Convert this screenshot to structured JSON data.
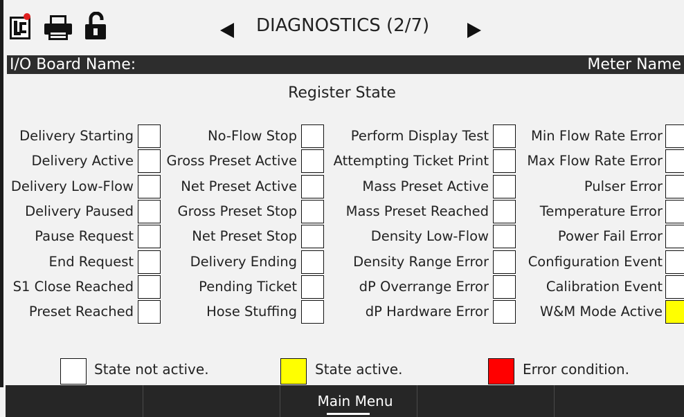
{
  "header": {
    "title": "DIAGNOSTICS (2/7)",
    "icons": [
      "app-logo-icon",
      "printer-icon",
      "unlock-icon",
      "prev-arrow-icon",
      "next-arrow-icon"
    ]
  },
  "board": {
    "label": "I/O Board Name:",
    "meter_name": "Meter Name"
  },
  "section_title": "Register State",
  "colors": {
    "inactive": "#ffffff",
    "active": "#ffff00",
    "error": "#ff0000"
  },
  "registers": {
    "col1": [
      {
        "label": "Delivery Starting",
        "state": "inactive"
      },
      {
        "label": "Delivery Active",
        "state": "inactive"
      },
      {
        "label": "Delivery Low-Flow",
        "state": "inactive"
      },
      {
        "label": "Delivery Paused",
        "state": "inactive"
      },
      {
        "label": "Pause Request",
        "state": "inactive"
      },
      {
        "label": "End Request",
        "state": "inactive"
      },
      {
        "label": "S1 Close Reached",
        "state": "inactive"
      },
      {
        "label": "Preset Reached",
        "state": "inactive"
      }
    ],
    "col2": [
      {
        "label": "No-Flow Stop",
        "state": "inactive"
      },
      {
        "label": "Gross Preset Active",
        "state": "inactive"
      },
      {
        "label": "Net Preset Active",
        "state": "inactive"
      },
      {
        "label": "Gross Preset Stop",
        "state": "inactive"
      },
      {
        "label": "Net Preset Stop",
        "state": "inactive"
      },
      {
        "label": "Delivery Ending",
        "state": "inactive"
      },
      {
        "label": "Pending Ticket",
        "state": "inactive"
      },
      {
        "label": "Hose Stuffing",
        "state": "inactive"
      }
    ],
    "col3": [
      {
        "label": "Perform Display Test",
        "state": "inactive"
      },
      {
        "label": "Attempting Ticket Print",
        "state": "inactive"
      },
      {
        "label": "Mass Preset Active",
        "state": "inactive"
      },
      {
        "label": "Mass Preset Reached",
        "state": "inactive"
      },
      {
        "label": "Density Low-Flow",
        "state": "inactive"
      },
      {
        "label": "Density Range Error",
        "state": "inactive"
      },
      {
        "label": "dP Overrange Error",
        "state": "inactive"
      },
      {
        "label": "dP Hardware Error",
        "state": "inactive"
      }
    ],
    "col4": [
      {
        "label": "Min Flow Rate Error",
        "state": "inactive"
      },
      {
        "label": "Max Flow Rate Error",
        "state": "inactive"
      },
      {
        "label": "Pulser Error",
        "state": "inactive"
      },
      {
        "label": "Temperature Error",
        "state": "inactive"
      },
      {
        "label": "Power Fail Error",
        "state": "inactive"
      },
      {
        "label": "Configuration Event",
        "state": "inactive"
      },
      {
        "label": "Calibration Event",
        "state": "inactive"
      },
      {
        "label": "W&M Mode Active",
        "state": "active"
      }
    ]
  },
  "legend": {
    "inactive": "State not active.",
    "active": "State active.",
    "error": "Error condition."
  },
  "bottom_bar": {
    "main_menu": "Main Menu"
  }
}
